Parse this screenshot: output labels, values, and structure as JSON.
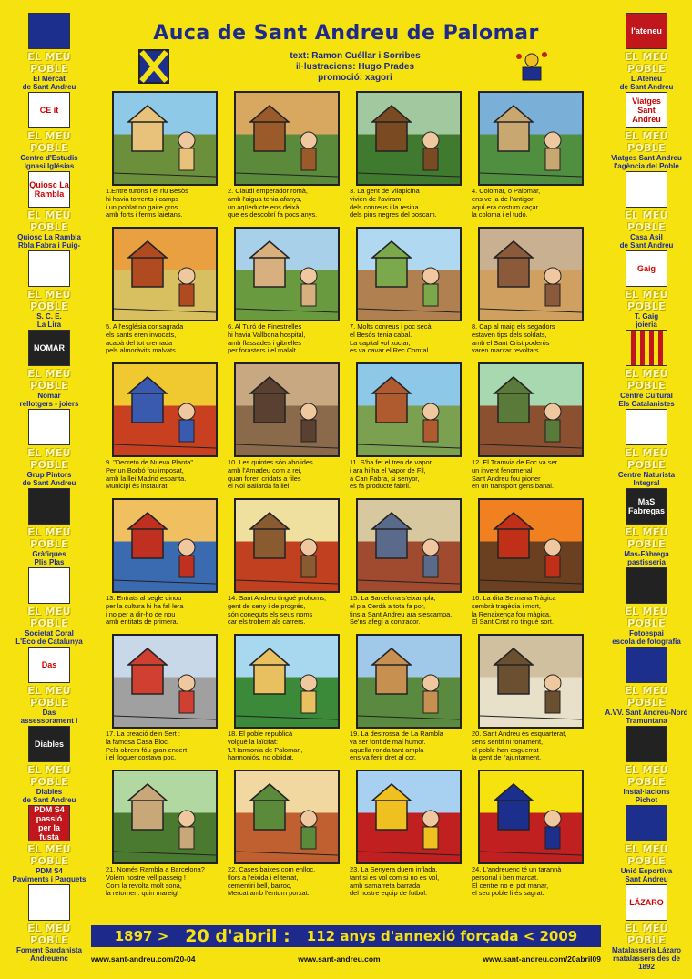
{
  "title": "Auca de Sant Andreu de Palomar",
  "credits": [
    "text: Ramon Cuéllar i Sorribes",
    "il·lustracions: Hugo Prades",
    "promoció: xagori"
  ],
  "side_tag": "EL MEU POBLE",
  "left_sponsors": [
    {
      "logo": "",
      "name": "El Mercat\nde Sant Andreu",
      "style": "blue"
    },
    {
      "logo": "CE it",
      "name": "Centre d'Estudis\nIgnasi Iglésias",
      "style": ""
    },
    {
      "logo": "Quiosc La Rambla",
      "name": "Quiosc La Rambla\nRbla Fabra i Puig-Neopàtria",
      "style": ""
    },
    {
      "logo": "",
      "name": "S. C. E.\nLa Lira",
      "style": ""
    },
    {
      "logo": "NOMAR",
      "name": "Nomar\nrellotgers - joiers",
      "style": "dark"
    },
    {
      "logo": "",
      "name": "Grup Pintors\nde Sant Andreu",
      "style": ""
    },
    {
      "logo": "",
      "name": "Gràfiques\nPlis Plas",
      "style": "dark"
    },
    {
      "logo": "",
      "name": "Societat Coral\nL'Eco de Catalunya",
      "style": ""
    },
    {
      "logo": "Das",
      "name": "Das\nassessorament i serveis",
      "style": ""
    },
    {
      "logo": "Diables",
      "name": "Diables\nde Sant Andreu",
      "style": "dark"
    },
    {
      "logo": "PDM S4 passió per la fusta",
      "name": "PDM S4\nPaviments i Parquets",
      "style": "red"
    },
    {
      "logo": "",
      "name": "Foment Sardanista\nAndreuenc",
      "style": ""
    }
  ],
  "right_sponsors": [
    {
      "logo": "l'ateneu",
      "name": "L'Ateneu\nde Sant Andreu",
      "style": "red"
    },
    {
      "logo": "Viatges Sant Andreu",
      "name": "Viatges Sant Andreu\nl'agència del Poble",
      "style": ""
    },
    {
      "logo": "",
      "name": "Casa Asil\nde Sant Andreu",
      "style": ""
    },
    {
      "logo": "Gaig",
      "name": "T. Gaig\njoieria",
      "style": ""
    },
    {
      "logo": "",
      "name": "Centre Cultural\nEls Catalanistes",
      "style": "cat"
    },
    {
      "logo": "",
      "name": "Centre Naturista\nIntegral",
      "style": ""
    },
    {
      "logo": "MaS Fabregas",
      "name": "Mas-Fàbrega\npastisseria",
      "style": "dark"
    },
    {
      "logo": "",
      "name": "Fotoespai\nescola de fotografia",
      "style": "dark"
    },
    {
      "logo": "",
      "name": "A.VV. Sant Andreu-Nord\nTramuntana",
      "style": "blue"
    },
    {
      "logo": "",
      "name": "Instal·lacions\nPichot",
      "style": "dark"
    },
    {
      "logo": "",
      "name": "Unió Esportiva\nSant Andreu",
      "style": "blue"
    },
    {
      "logo": "LÁZARO",
      "name": "Matalasseria Lázaro\nmatalassers des de 1892",
      "style": ""
    }
  ],
  "panels": [
    {
      "caption": "1.Entre turons i el riu Besòs\nhi havia torrents i camps\ni un poblat no gaire gros\namb forts i ferms laietans.",
      "c": [
        "#8fc9e8",
        "#e8c27a",
        "#6b8f3a"
      ]
    },
    {
      "caption": "2. Claudi emperador romà,\namb l'aigua tenia afanys,\nun aqüeducte ens deixà\nque es descobrí fa pocs anys.",
      "c": [
        "#d8a860",
        "#9a5a2a",
        "#5a8a3a"
      ]
    },
    {
      "caption": "3. La gent de Vilapicina\nvivien de l'aviram,\ndels conreus i la resina\ndels pins negres del boscam.",
      "c": [
        "#a2c8a0",
        "#7a4a22",
        "#3f7a2f"
      ]
    },
    {
      "caption": "4. Colomar, o Palomar,\nens ve ja de l'antigor\naquí era costum caçar\nla coloma i el tudó.",
      "c": [
        "#7ab0d8",
        "#c8a870",
        "#4f8f3f"
      ]
    },
    {
      "caption": "5. A l'església consagrada\nels sants eren invocats,\nacabà del tot cremada\npels almoràvits malvats.",
      "c": [
        "#e8a040",
        "#b04a20",
        "#d8c060"
      ]
    },
    {
      "caption": "6. Al Turó de Finestrelles\nhi havia Vallbona hospital,\namb flassades i gibrelles\nper forasters i el malalt.",
      "c": [
        "#a8d0e8",
        "#d8b080",
        "#6a9a40"
      ]
    },
    {
      "caption": "7. Molts conreus i poc secà,\nel Besòs tenia cabal.\nLa capital vol xuclar,\nes va cavar el Rec Comtal.",
      "c": [
        "#b0d8f0",
        "#7aa84a",
        "#b08050"
      ]
    },
    {
      "caption": "8. Cap al maig els segadors\nestaven tips dels soldats,\namb el Sant Crist poderós\nvaren marxar revoltats.",
      "c": [
        "#c8b090",
        "#8a5a3a",
        "#d0a060"
      ]
    },
    {
      "caption": "9. \"Decreto de Nueva Planta\".\nPer un Borbó fou imposat,\namb la llei Madrid espanta.\nMunicipi és instaurat.",
      "c": [
        "#f0c830",
        "#3a5ab0",
        "#c84020"
      ]
    },
    {
      "caption": "10. Les quintes són abolides\namb l'Amadeu com a rei,\nquan foren cridats a files\nel Noi Baliarda fa llei.",
      "c": [
        "#c8a880",
        "#5a4030",
        "#8a6a4a"
      ]
    },
    {
      "caption": "11. S'ha fet el tren de vapor\ni ara hi ha el Vapor de Fil,\na Can Fabra, si senyor,\nes fa producte fabril.",
      "c": [
        "#8ec8e8",
        "#b05a30",
        "#7aa050"
      ]
    },
    {
      "caption": "12. El Tramvia de Foc va ser\nun invent fenomenal\nSant Andreu fou pioner\nen un transport gens banal.",
      "c": [
        "#a8d8b0",
        "#5a7a3a",
        "#8a5030"
      ]
    },
    {
      "caption": "13. Entrats al segle dinou\nper la cultura hi ha fal·lera\ni no per a dir-ho de nou\namb entitats de primera.",
      "c": [
        "#f0c060",
        "#c03020",
        "#3a6ab0"
      ]
    },
    {
      "caption": "14. Sant Andreu tingué prohoms,\ngent de seny i de progrés,\nsón coneguts els seus noms\ncar els trobem als carrers.",
      "c": [
        "#f0e0a0",
        "#8a5a30",
        "#c04020"
      ]
    },
    {
      "caption": "15. La Barcelona s'eixampla,\nel pla Cerdà a tota fa por,\nfins a Sant Andreu ara s'escampa.\nSe'ns afegí a contracor.",
      "c": [
        "#d8c8a0",
        "#5a6a8a",
        "#a04a30"
      ]
    },
    {
      "caption": "16. La dita Setmana Tràgica\nsembrà tragèdia i mort,\nla Renaixença fou màgica.\nEl Sant Crist no tingué sort.",
      "c": [
        "#f08020",
        "#c03018",
        "#6a4020"
      ]
    },
    {
      "caption": "17. La creació de'n Sert :\nla famosa Casa Bloc.\nPels obrers fóu gran encert\ni el lloguer costava poc.",
      "c": [
        "#c8d8e8",
        "#d04030",
        "#a0a0a0"
      ]
    },
    {
      "caption": "18. El poble republicà\nvolgué la laïcitat:\n'L'Harmonia de Palomar',\nharmoniós, no oblidat.",
      "c": [
        "#a8d8f0",
        "#e8c060",
        "#3a8a3a"
      ]
    },
    {
      "caption": "19. La destrossa de La Rambla\nva ser font de mal humor.\naquella ronda tant ampla\nens va ferir dret al cor.",
      "c": [
        "#a0c8e8",
        "#c89050",
        "#5a8a40"
      ]
    },
    {
      "caption": "20. Sant Andreu és esquarterat,\nsens sentit ni fonament,\nel poble han esguerrat\nla gent de l'ajuntament.",
      "c": [
        "#d0c0a0",
        "#6a5030",
        "#e8e0c8"
      ]
    },
    {
      "caption": "21. Només Rambla a Barcelona?\nVolem nostre vell passeig !\nCom la revolta molt sona,\nla retornen: quin mareig!",
      "c": [
        "#b0d8a0",
        "#c8a878",
        "#4a7a30"
      ]
    },
    {
      "caption": "22. Cases baixes com enlloc,\nflors a l'eixida i el terrat,\ncementiri bell, barroc,\nMercat amb l'entorn porxat.",
      "c": [
        "#f0d8a0",
        "#5a8a3a",
        "#c06030"
      ]
    },
    {
      "caption": "23. La Senyera duem inflada,\ntant si es vol com si no es vol,\namb samarreta barrada\ndel nostre equip de futbol.",
      "c": [
        "#a8d0f0",
        "#f0c020",
        "#c02020"
      ]
    },
    {
      "caption": "24. L'andreuenc té un tarannà\npersonal i ben marcat.\nEl centre no el pot manar,\nel seu poble li és sagrat.",
      "c": [
        "#f5e20e",
        "#1d2f8c",
        "#c02020"
      ]
    }
  ],
  "banner": {
    "left": "1897 >",
    "middle": "20 d'abril :",
    "right": "112 anys d'annexió forçada  < 2009"
  },
  "urls": [
    "www.sant-andreu.com/20-04",
    "www.sant-andreu.com",
    "www.sant-andreu.com/20abril09"
  ]
}
